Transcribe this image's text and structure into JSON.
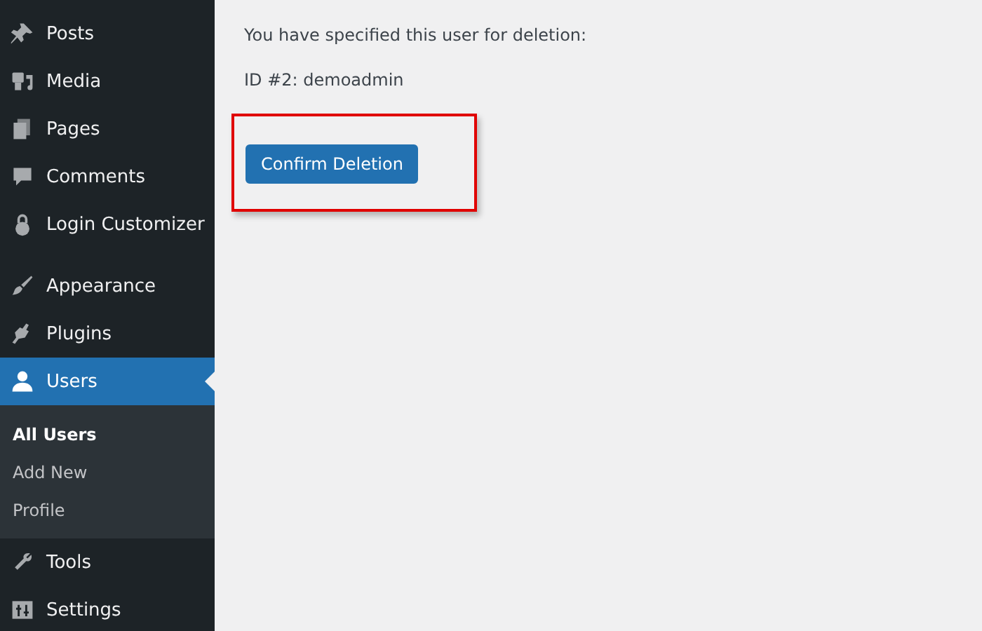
{
  "sidebar": {
    "groups": [
      [
        {
          "label": "Posts",
          "selected": false
        },
        {
          "label": "Media",
          "selected": false
        },
        {
          "label": "Pages",
          "selected": false
        },
        {
          "label": "Comments",
          "selected": false
        },
        {
          "label": "Login Customizer",
          "selected": false
        }
      ],
      [
        {
          "label": "Appearance",
          "selected": false
        },
        {
          "label": "Plugins",
          "selected": false
        },
        {
          "label": "Users",
          "selected": true,
          "children": [
            {
              "label": "All Users",
              "selected": true
            },
            {
              "label": "Add New",
              "selected": false
            },
            {
              "label": "Profile",
              "selected": false
            }
          ]
        },
        {
          "label": "Tools",
          "selected": false
        },
        {
          "label": "Settings",
          "selected": false
        }
      ]
    ]
  },
  "content": {
    "message": "You have specified this user for deletion:",
    "user_line": "ID #2: demoadmin",
    "button": {
      "label": "Confirm Deletion",
      "highlighted": true
    }
  }
}
